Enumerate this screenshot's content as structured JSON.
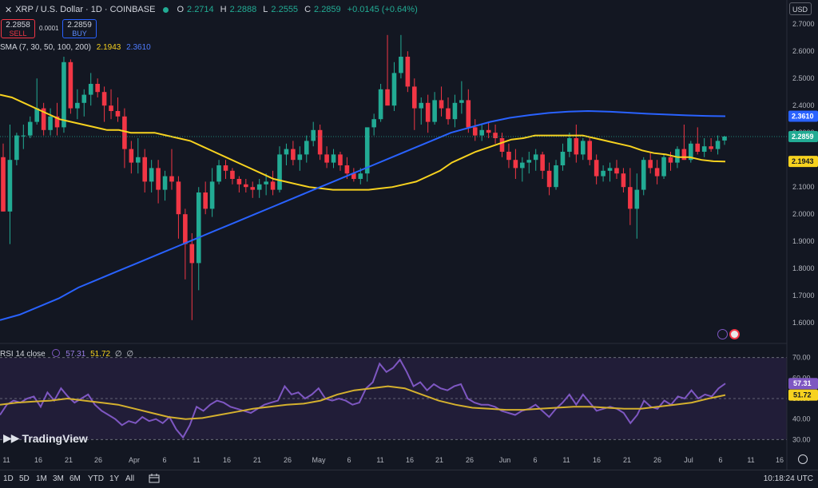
{
  "header": {
    "symbol": "XRP / U.S. Dollar · 1D · COINBASE",
    "open_label": "O",
    "open": "2.2714",
    "high_label": "H",
    "high": "2.2888",
    "low_label": "L",
    "low": "2.2555",
    "close_label": "C",
    "close": "2.2859",
    "change": "+0.0145 (+0.64%)"
  },
  "trade": {
    "sell_price": "2.2858",
    "sell_label": "SELL",
    "buy_price": "2.2859",
    "buy_label": "BUY",
    "spread": "0.0001"
  },
  "sma_legend": {
    "label": "SMA (7, 30, 50, 100, 200)",
    "v1": "2.1943",
    "v2": "2.3610"
  },
  "rsi_legend": {
    "label": "RSI 14 close",
    "v1": "57.31",
    "v2": "51.72",
    "v3": "∅",
    "v4": "∅"
  },
  "currency": "USD",
  "brand": "TradingView",
  "bottom_bar": {
    "ranges": [
      "1D",
      "5D",
      "1M",
      "3M",
      "6M",
      "YTD",
      "1Y",
      "All"
    ],
    "clock": "10:18:24 UTC"
  },
  "colors": {
    "background": "#131722",
    "up": "#22ab94",
    "down": "#f23645",
    "sma_yellow": "#f7d21f",
    "sma_blue": "#2962ff",
    "rsi": "#7e57c2"
  },
  "chart_data": {
    "type": "candlestick",
    "x_ticks": [
      "11",
      "16",
      "21",
      "26",
      "Apr",
      "6",
      "11",
      "16",
      "21",
      "26",
      "May",
      "6",
      "11",
      "16",
      "21",
      "26",
      "Jun",
      "6",
      "11",
      "16",
      "21",
      "26",
      "Jul",
      "6",
      "11",
      "16"
    ],
    "y_ticks": [
      "2.7000",
      "2.6000",
      "2.5000",
      "2.4000",
      "2.3000",
      "2.2000",
      "2.1000",
      "2.0000",
      "1.9000",
      "1.8000",
      "1.7000",
      "1.6000"
    ],
    "ylim": [
      1.53,
      2.73
    ],
    "last_price": 2.2859,
    "price_labels": [
      {
        "value": 2.361,
        "text": "2.3610",
        "color": "#2962ff"
      },
      {
        "value": 2.2859,
        "text": "2.2859",
        "color": "#22ab94"
      },
      {
        "value": 2.1943,
        "text": "2.1943",
        "color": "#f7d21f"
      }
    ],
    "candles": [
      [
        2.21,
        2.26,
        2.01,
        2.01
      ],
      [
        2.01,
        2.33,
        1.89,
        2.2
      ],
      [
        2.2,
        2.3,
        2.18,
        2.29
      ],
      [
        2.29,
        2.33,
        2.24,
        2.29
      ],
      [
        2.29,
        2.36,
        2.28,
        2.34
      ],
      [
        2.34,
        2.5,
        2.33,
        2.39
      ],
      [
        2.39,
        2.41,
        2.29,
        2.31
      ],
      [
        2.31,
        2.39,
        2.29,
        2.36
      ],
      [
        2.36,
        2.41,
        2.29,
        2.32
      ],
      [
        2.32,
        2.58,
        2.3,
        2.56
      ],
      [
        2.56,
        2.57,
        2.37,
        2.39
      ],
      [
        2.39,
        2.46,
        2.35,
        2.41
      ],
      [
        2.41,
        2.46,
        2.36,
        2.44
      ],
      [
        2.44,
        2.52,
        2.4,
        2.48
      ],
      [
        2.48,
        2.5,
        2.43,
        2.45
      ],
      [
        2.45,
        2.47,
        2.34,
        2.4
      ],
      [
        2.4,
        2.46,
        2.35,
        2.38
      ],
      [
        2.38,
        2.43,
        2.34,
        2.36
      ],
      [
        2.36,
        2.39,
        2.17,
        2.24
      ],
      [
        2.24,
        2.27,
        2.15,
        2.19
      ],
      [
        2.19,
        2.28,
        2.15,
        2.21
      ],
      [
        2.21,
        2.24,
        2.08,
        2.12
      ],
      [
        2.12,
        2.2,
        2.08,
        2.17
      ],
      [
        2.17,
        2.2,
        2.04,
        2.09
      ],
      [
        2.09,
        2.16,
        2.05,
        2.14
      ],
      [
        2.14,
        2.24,
        2.09,
        2.12
      ],
      [
        2.12,
        2.14,
        1.91,
        2.0
      ],
      [
        2.0,
        2.02,
        1.76,
        1.89
      ],
      [
        1.89,
        1.93,
        1.61,
        1.82
      ],
      [
        1.82,
        2.1,
        1.72,
        2.08
      ],
      [
        2.08,
        2.12,
        2.0,
        2.02
      ],
      [
        2.02,
        2.17,
        1.99,
        2.12
      ],
      [
        2.12,
        2.2,
        2.11,
        2.18
      ],
      [
        2.18,
        2.2,
        2.13,
        2.16
      ],
      [
        2.16,
        2.17,
        2.11,
        2.13
      ],
      [
        2.13,
        2.14,
        2.08,
        2.11
      ],
      [
        2.11,
        2.13,
        2.08,
        2.1
      ],
      [
        2.1,
        2.12,
        2.06,
        2.09
      ],
      [
        2.09,
        2.13,
        2.06,
        2.11
      ],
      [
        2.11,
        2.15,
        2.07,
        2.12
      ],
      [
        2.12,
        2.16,
        2.07,
        2.09
      ],
      [
        2.09,
        2.25,
        2.08,
        2.22
      ],
      [
        2.22,
        2.26,
        2.18,
        2.24
      ],
      [
        2.24,
        2.27,
        2.18,
        2.2
      ],
      [
        2.2,
        2.25,
        2.16,
        2.22
      ],
      [
        2.22,
        2.29,
        2.19,
        2.27
      ],
      [
        2.27,
        2.34,
        2.25,
        2.31
      ],
      [
        2.31,
        2.33,
        2.2,
        2.22
      ],
      [
        2.22,
        2.25,
        2.17,
        2.19
      ],
      [
        2.19,
        2.24,
        2.17,
        2.22
      ],
      [
        2.22,
        2.23,
        2.16,
        2.18
      ],
      [
        2.18,
        2.21,
        2.13,
        2.15
      ],
      [
        2.15,
        2.17,
        2.12,
        2.13
      ],
      [
        2.13,
        2.17,
        2.11,
        2.15
      ],
      [
        2.15,
        2.29,
        2.12,
        2.32
      ],
      [
        2.32,
        2.37,
        2.29,
        2.35
      ],
      [
        2.35,
        2.48,
        2.34,
        2.46
      ],
      [
        2.46,
        2.66,
        2.43,
        2.4
      ],
      [
        2.4,
        2.56,
        2.38,
        2.52
      ],
      [
        2.52,
        2.66,
        2.5,
        2.58
      ],
      [
        2.58,
        2.6,
        2.45,
        2.47
      ],
      [
        2.47,
        2.5,
        2.31,
        2.39
      ],
      [
        2.39,
        2.43,
        2.33,
        2.41
      ],
      [
        2.41,
        2.44,
        2.3,
        2.34
      ],
      [
        2.34,
        2.45,
        2.33,
        2.42
      ],
      [
        2.42,
        2.47,
        2.36,
        2.39
      ],
      [
        2.39,
        2.43,
        2.33,
        2.35
      ],
      [
        2.35,
        2.44,
        2.32,
        2.41
      ],
      [
        2.41,
        2.49,
        2.37,
        2.42
      ],
      [
        2.42,
        2.46,
        2.3,
        2.32
      ],
      [
        2.32,
        2.35,
        2.27,
        2.29
      ],
      [
        2.29,
        2.33,
        2.27,
        2.31
      ],
      [
        2.31,
        2.34,
        2.28,
        2.3
      ],
      [
        2.3,
        2.33,
        2.26,
        2.28
      ],
      [
        2.28,
        2.3,
        2.21,
        2.23
      ],
      [
        2.23,
        2.26,
        2.17,
        2.2
      ],
      [
        2.2,
        2.24,
        2.13,
        2.17
      ],
      [
        2.17,
        2.21,
        2.12,
        2.19
      ],
      [
        2.19,
        2.23,
        2.15,
        2.2
      ],
      [
        2.2,
        2.24,
        2.16,
        2.22
      ],
      [
        2.22,
        2.23,
        2.13,
        2.16
      ],
      [
        2.16,
        2.19,
        2.07,
        2.1
      ],
      [
        2.1,
        2.2,
        2.09,
        2.18
      ],
      [
        2.18,
        2.26,
        2.16,
        2.23
      ],
      [
        2.23,
        2.3,
        2.21,
        2.28
      ],
      [
        2.28,
        2.33,
        2.19,
        2.22
      ],
      [
        2.22,
        2.28,
        2.2,
        2.27
      ],
      [
        2.27,
        2.28,
        2.18,
        2.2
      ],
      [
        2.2,
        2.22,
        2.11,
        2.14
      ],
      [
        2.14,
        2.18,
        2.12,
        2.16
      ],
      [
        2.16,
        2.19,
        2.12,
        2.17
      ],
      [
        2.17,
        2.2,
        2.13,
        2.15
      ],
      [
        2.15,
        2.17,
        2.08,
        2.1
      ],
      [
        2.1,
        2.17,
        1.96,
        2.02
      ],
      [
        2.02,
        2.15,
        1.91,
        2.09
      ],
      [
        2.09,
        2.21,
        2.07,
        2.2
      ],
      [
        2.2,
        2.23,
        2.15,
        2.17
      ],
      [
        2.17,
        2.2,
        2.11,
        2.14
      ],
      [
        2.14,
        2.22,
        2.13,
        2.21
      ],
      [
        2.21,
        2.23,
        2.16,
        2.19
      ],
      [
        2.19,
        2.25,
        2.17,
        2.24
      ],
      [
        2.24,
        2.33,
        2.2,
        2.2
      ],
      [
        2.2,
        2.27,
        2.19,
        2.26
      ],
      [
        2.26,
        2.32,
        2.22,
        2.23
      ],
      [
        2.23,
        2.28,
        2.21,
        2.25
      ],
      [
        2.25,
        2.28,
        2.23,
        2.24
      ],
      [
        2.24,
        2.29,
        2.22,
        2.27
      ],
      [
        2.2714,
        2.2888,
        2.2555,
        2.2859
      ]
    ],
    "sma_yellow": [
      2.44,
      2.43,
      2.41,
      2.39,
      2.37,
      2.35,
      2.34,
      2.33,
      2.32,
      2.31,
      2.31,
      2.3,
      2.3,
      2.3,
      2.29,
      2.28,
      2.27,
      2.25,
      2.23,
      2.21,
      2.19,
      2.17,
      2.15,
      2.13,
      2.12,
      2.11,
      2.1,
      2.095,
      2.09,
      2.09,
      2.09,
      2.09,
      2.095,
      2.1,
      2.11,
      2.12,
      2.14,
      2.16,
      2.19,
      2.21,
      2.23,
      2.245,
      2.26,
      2.275,
      2.28,
      2.29,
      2.29,
      2.29,
      2.29,
      2.29,
      2.28,
      2.27,
      2.26,
      2.25,
      2.235,
      2.225,
      2.22,
      2.21,
      2.21,
      2.2,
      2.195,
      2.194
    ],
    "sma_blue": [
      1.61,
      1.63,
      1.66,
      1.69,
      1.73,
      1.76,
      1.79,
      1.82,
      1.85,
      1.88,
      1.91,
      1.94,
      1.97,
      2.0,
      2.03,
      2.06,
      2.09,
      2.12,
      2.15,
      2.18,
      2.21,
      2.24,
      2.27,
      2.3,
      2.32,
      2.34,
      2.355,
      2.365,
      2.373,
      2.378,
      2.38,
      2.378,
      2.374,
      2.37,
      2.367,
      2.364,
      2.362,
      2.361
    ],
    "rsi": {
      "ylim": [
        27,
        73
      ],
      "y_ticks": [
        "70.00",
        "60.00",
        "50.00",
        "40.00",
        "30.00"
      ],
      "levels": [
        70,
        50,
        30
      ],
      "last_rsi": 57.31,
      "last_ma": 51.72,
      "rsi_values": [
        42,
        47,
        49,
        48,
        50,
        51,
        46,
        53,
        49,
        55,
        51,
        48,
        50,
        52,
        47,
        44,
        42,
        40,
        37,
        39,
        38,
        41,
        39,
        40,
        38,
        41,
        35,
        31,
        37,
        46,
        44,
        47,
        49,
        48,
        46,
        45,
        44,
        43,
        45,
        47,
        48,
        49,
        56,
        52,
        53,
        50,
        52,
        55,
        50,
        49,
        50,
        49,
        47,
        48,
        55,
        58,
        67,
        63,
        65,
        69,
        63,
        56,
        58,
        54,
        57,
        55,
        54,
        56,
        57,
        50,
        48,
        47,
        47,
        46,
        44,
        43,
        42,
        44,
        45,
        47,
        44,
        41,
        45,
        48,
        52,
        47,
        52,
        48,
        44,
        45,
        46,
        45,
        43,
        38,
        42,
        49,
        46,
        45,
        49,
        47,
        51,
        50,
        54,
        50,
        52,
        51,
        55,
        57.31
      ],
      "ma_values": [
        47,
        48,
        48.5,
        49,
        50,
        49,
        48,
        47,
        45,
        43,
        41,
        40,
        40.5,
        42,
        43.5,
        45,
        46,
        47,
        47.5,
        49,
        52,
        54,
        55,
        56,
        55,
        52,
        49,
        47,
        45.5,
        45,
        44.5,
        44.5,
        45,
        45.5,
        46,
        46,
        45.5,
        45,
        45,
        46,
        47,
        48,
        50,
        51.72
      ]
    }
  }
}
